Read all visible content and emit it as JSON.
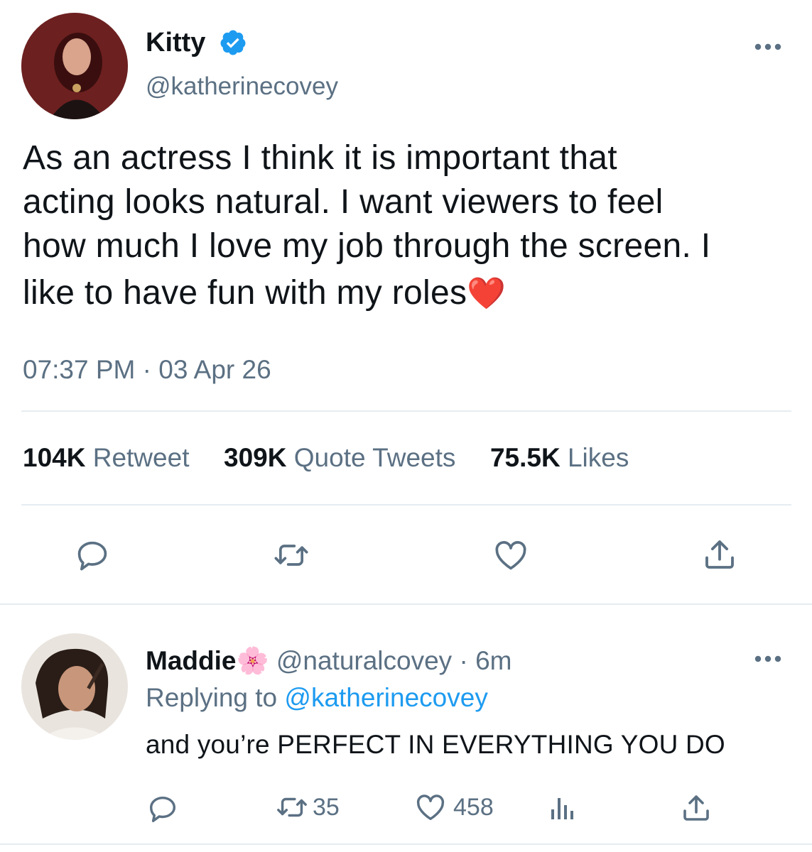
{
  "tweet": {
    "display_name": "Kitty",
    "verified": true,
    "handle": "@katherinecovey",
    "text_lines": [
      "As an actress I think it is important that",
      "acting looks natural. I want viewers to feel",
      "how much I love my job through the screen. I",
      "like to have fun with my roles"
    ],
    "emoji": "❤️",
    "timestamp": "07:37 PM · 03 Apr 26",
    "stats": {
      "retweets_count": "104K",
      "retweets_label": "Retweet",
      "quotes_count": "309K",
      "quotes_label": "Quote Tweets",
      "likes_count": "75.5K",
      "likes_label": "Likes"
    },
    "actions": [
      "reply",
      "retweet",
      "like",
      "share"
    ]
  },
  "reply": {
    "display_name": "Maddie",
    "emoji": "🌸",
    "handle": "@naturalcovey",
    "time": "· 6m",
    "replying_prefix": "Replying to",
    "replying_handle": "@katherinecovey",
    "text": "and you’re PERFECT IN EVERYTHING YOU DO",
    "retweet_count": "35",
    "like_count": "458"
  },
  "colors": {
    "text": "#0f1419",
    "muted": "#5b7083",
    "link": "#1d9bf0",
    "verified": "#1d9bf0",
    "divider": "#e6ecf0",
    "heart": "#e0245e"
  }
}
